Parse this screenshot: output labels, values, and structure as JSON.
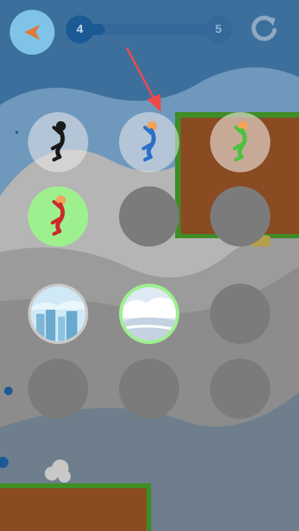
{
  "header": {
    "back_button": "orange-back-arrow-icon",
    "level_current": "4",
    "level_next": "5",
    "progress_fraction": 0.12,
    "restart_button": "restart-icon"
  },
  "grid": {
    "rows": 4,
    "columns": 3,
    "cells": [
      {
        "kind": "character",
        "character_color": "#1a1a1a",
        "selected": false
      },
      {
        "kind": "character",
        "character_color": "#2c6fc9",
        "selected": false,
        "pointed_at": true
      },
      {
        "kind": "character",
        "character_color": "#4ac23d",
        "selected": false
      },
      {
        "kind": "character",
        "character_color": "#cc2a2a",
        "selected": true
      },
      {
        "kind": "locked"
      },
      {
        "kind": "locked"
      },
      {
        "kind": "background",
        "theme": "city",
        "selected": false
      },
      {
        "kind": "background",
        "theme": "clouds",
        "selected": true
      },
      {
        "kind": "locked"
      },
      {
        "kind": "locked"
      },
      {
        "kind": "locked"
      },
      {
        "kind": "locked"
      }
    ]
  },
  "colors": {
    "sky_top": "#3c6e9c",
    "accent_green": "#9ef08f",
    "dirt": "#8a4a22",
    "grass": "#3f8d25",
    "pointer_arrow": "#ee4a4a"
  }
}
